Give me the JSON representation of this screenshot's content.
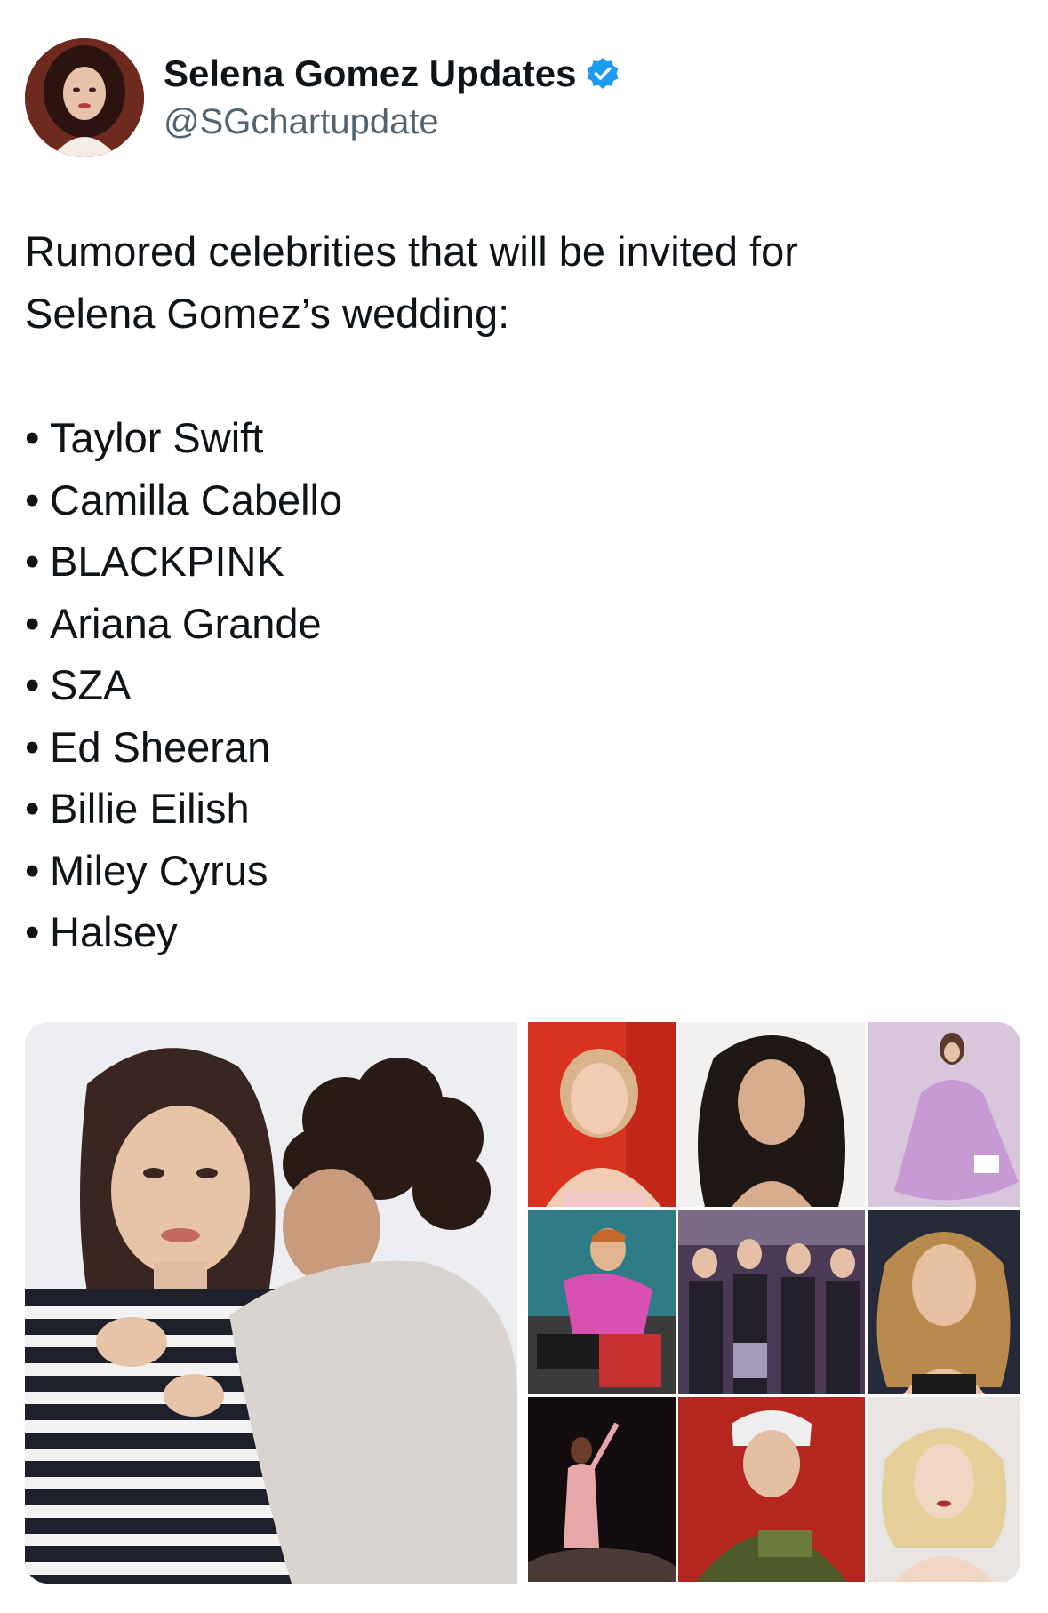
{
  "author": {
    "display_name": "Selena Gomez Updates",
    "handle": "@SGchartupdate",
    "verified": true,
    "verified_color": "#1d9bf0",
    "avatar_icon": "profile-photo"
  },
  "tweet": {
    "intro_line_1": "Rumored celebrities that will be invited for",
    "intro_line_2": "Selena Gomez’s wedding:",
    "bullet": "•",
    "names": [
      "Taylor Swift",
      "Camilla Cabello",
      "BLACKPINK",
      "Ariana Grande",
      "SZA",
      "Ed Sheeran",
      "Billie Eilish",
      "Miley Cyrus",
      "Halsey"
    ]
  },
  "media": {
    "left_photo": "couple-photo",
    "grid_photos": [
      "taylor-swift-photo",
      "camila-cabello-photo",
      "ariana-grande-photo",
      "ed-sheeran-photo",
      "blackpink-photo",
      "miley-cyrus-photo",
      "sza-photo",
      "billie-eilish-photo",
      "halsey-photo"
    ]
  }
}
